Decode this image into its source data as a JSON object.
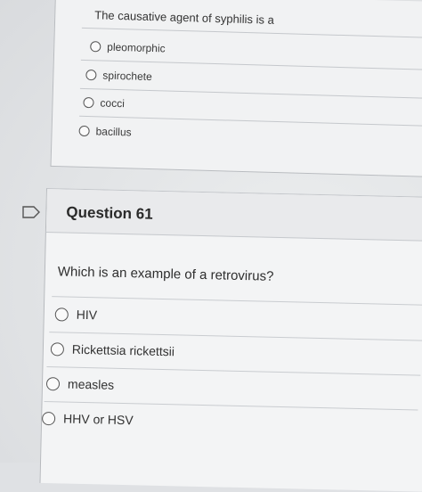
{
  "previous_question": {
    "text": "The causative agent of syphilis is a",
    "options": [
      "pleomorphic",
      "spirochete",
      "cocci",
      "bacillus"
    ]
  },
  "question": {
    "title": "Question 61",
    "text": "Which is an example of a retrovirus?",
    "options": [
      "HIV",
      "Rickettsia rickettsii",
      "measles",
      "HHV or HSV"
    ]
  },
  "icons": {
    "flag": "flag-icon",
    "radio": "radio-button-icon"
  },
  "colors": {
    "background": "#dfe1e4",
    "card": "#f3f4f5",
    "header": "#e9eaec",
    "text": "#2b2b2b"
  }
}
